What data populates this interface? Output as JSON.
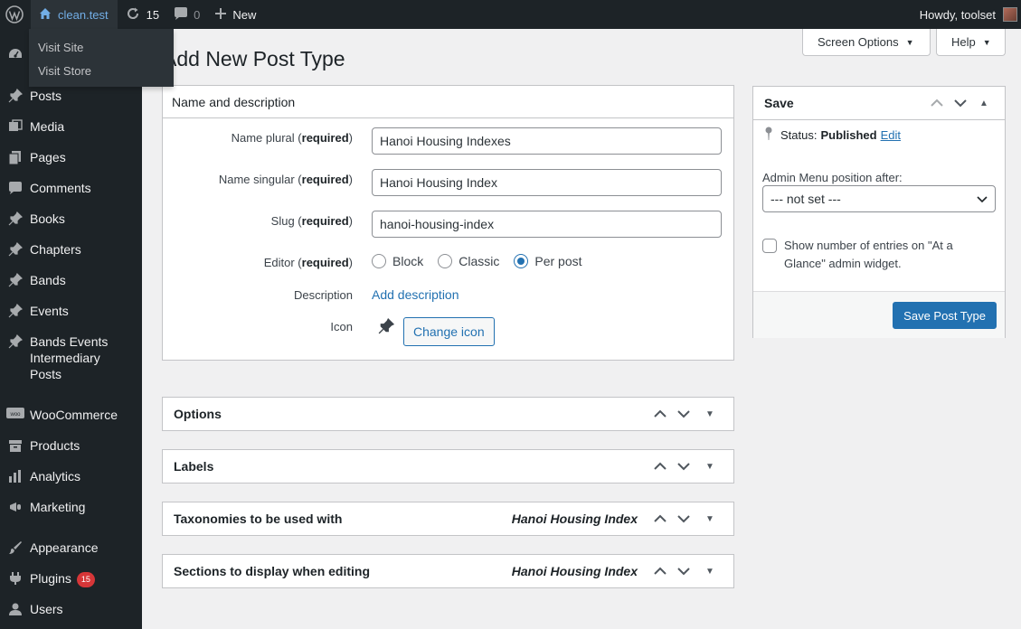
{
  "adminbar": {
    "site_name": "clean.test",
    "updates_count": "15",
    "comments_count": "0",
    "new_label": "New",
    "howdy": "Howdy, toolset"
  },
  "site_menu": {
    "visit_site": "Visit Site",
    "visit_store": "Visit Store"
  },
  "sidebar": {
    "items": [
      {
        "label": "Posts"
      },
      {
        "label": "Media"
      },
      {
        "label": "Pages"
      },
      {
        "label": "Comments"
      },
      {
        "label": "Books"
      },
      {
        "label": "Chapters"
      },
      {
        "label": "Bands"
      },
      {
        "label": "Events"
      },
      {
        "label": "Bands Events Intermediary Posts"
      },
      {
        "label": "WooCommerce"
      },
      {
        "label": "Products"
      },
      {
        "label": "Analytics"
      },
      {
        "label": "Marketing"
      },
      {
        "label": "Appearance"
      },
      {
        "label": "Plugins",
        "badge": "15"
      },
      {
        "label": "Users"
      }
    ]
  },
  "screen_meta": {
    "screen_options": "Screen Options",
    "help": "Help"
  },
  "page": {
    "title": "Add New Post Type"
  },
  "name_box": {
    "title": "Name and description",
    "required": "required",
    "name_plural_label": "Name plural",
    "name_plural_value": "Hanoi Housing Indexes",
    "name_singular_label": "Name singular",
    "name_singular_value": "Hanoi Housing Index",
    "slug_label": "Slug",
    "slug_value": "hanoi-housing-index",
    "editor_label": "Editor",
    "editor_options": [
      "Block",
      "Classic",
      "Per post"
    ],
    "editor_selected": "Per post",
    "description_label": "Description",
    "add_description": "Add description",
    "icon_label": "Icon",
    "change_icon": "Change icon"
  },
  "collapsed_boxes": [
    {
      "title": "Options",
      "note": ""
    },
    {
      "title": "Labels",
      "note": ""
    },
    {
      "title": "Taxonomies to be used with",
      "note": "Hanoi Housing Index"
    },
    {
      "title": "Sections to display when editing",
      "note": "Hanoi Housing Index"
    }
  ],
  "save_box": {
    "title": "Save",
    "status_label": "Status:",
    "status_value": "Published",
    "edit_link": "Edit",
    "menu_position_label": "Admin Menu position after:",
    "menu_position_value": "--- not set ---",
    "glance_label": "Show number of entries on \"At a Glance\" admin widget.",
    "glance_checked": false,
    "save_button": "Save Post Type"
  },
  "colors": {
    "accent": "#2271b1",
    "adminbar_bg": "#1d2327",
    "badge": "#d63638"
  }
}
